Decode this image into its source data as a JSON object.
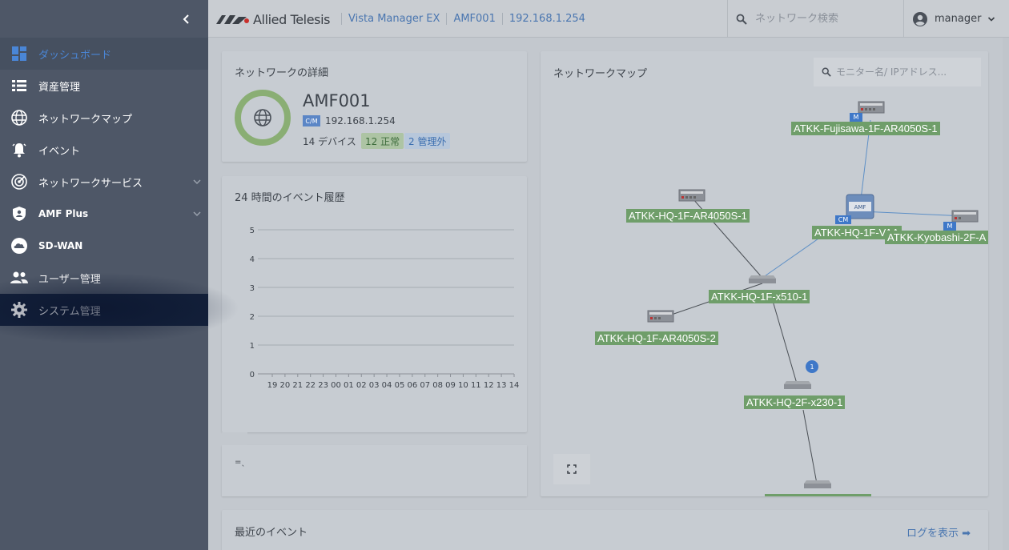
{
  "sidebar": {
    "items": [
      {
        "label": "ダッシュボード",
        "icon": "dashboard-icon",
        "active": true
      },
      {
        "label": "資産管理",
        "icon": "list-icon"
      },
      {
        "label": "ネットワークマップ",
        "icon": "globe-icon"
      },
      {
        "label": "イベント",
        "icon": "bell-icon"
      },
      {
        "label": "ネットワークサービス",
        "icon": "radar-icon",
        "expandable": true
      },
      {
        "label": "AMF Plus",
        "icon": "shield-icon",
        "expandable": true
      },
      {
        "label": "SD-WAN",
        "icon": "cloud-icon"
      },
      {
        "label": "ユーザー管理",
        "icon": "users-icon"
      },
      {
        "label": "システム管理",
        "icon": "gear-icon",
        "highlighted": true
      }
    ]
  },
  "header": {
    "brand": "Allied Telesis",
    "breadcrumbs": [
      "Vista Manager EX",
      "AMF001",
      "192.168.1.254"
    ],
    "search_placeholder": "ネットワーク検索",
    "user": "manager"
  },
  "network_details": {
    "title": "ネットワークの詳細",
    "name": "AMF001",
    "badge": "C/M",
    "ip": "192.168.1.254",
    "device_count": "14 デバイス",
    "normal": "12 正常",
    "unmanaged": "2 管理外"
  },
  "event_history": {
    "title": "24 時間のイベント履歴"
  },
  "chart_data": {
    "type": "bar",
    "title": "24 時間のイベント履歴",
    "categories": [
      "19",
      "20",
      "21",
      "22",
      "23",
      "00",
      "01",
      "02",
      "03",
      "04",
      "05",
      "06",
      "07",
      "08",
      "09",
      "10",
      "11",
      "12",
      "13",
      "14"
    ],
    "values": [
      0,
      0,
      0,
      0,
      0,
      0,
      0,
      0,
      0,
      0,
      0,
      0,
      0,
      0,
      0,
      0,
      0,
      0,
      0,
      0
    ],
    "ylim": [
      0,
      5
    ],
    "yticks": [
      "0",
      "1",
      "2",
      "3",
      "4",
      "5"
    ],
    "grid": true
  },
  "partial_card_text": "=ˎ",
  "network_map": {
    "title": "ネットワークマップ",
    "search_placeholder": "モニター名/ IPアドレス...",
    "nodes": [
      {
        "label": "ATKK-Fujisawa-1F-AR4050S-1",
        "badge": "M"
      },
      {
        "label": "ATKK-HQ-1F-AR4050S-1"
      },
      {
        "label": "ATKK-HQ-1F-VAA",
        "badge": "CM"
      },
      {
        "label": "ATKK-Kyobashi-2F-A",
        "badge": "M"
      },
      {
        "label": "ATKK-HQ-1F-x510-1"
      },
      {
        "label": "ATKK-HQ-1F-AR4050S-2"
      },
      {
        "label": "ATKK-HQ-2F-x230-1",
        "alert_count": "1"
      }
    ]
  },
  "recent_events": {
    "title": "最近のイベント",
    "link": "ログを表示 ➡"
  },
  "colors": {
    "sidebar_bg": "#4e5767",
    "accent": "#4a86d6",
    "node_label": "#6f9e6a",
    "donut": "#8aae74"
  }
}
